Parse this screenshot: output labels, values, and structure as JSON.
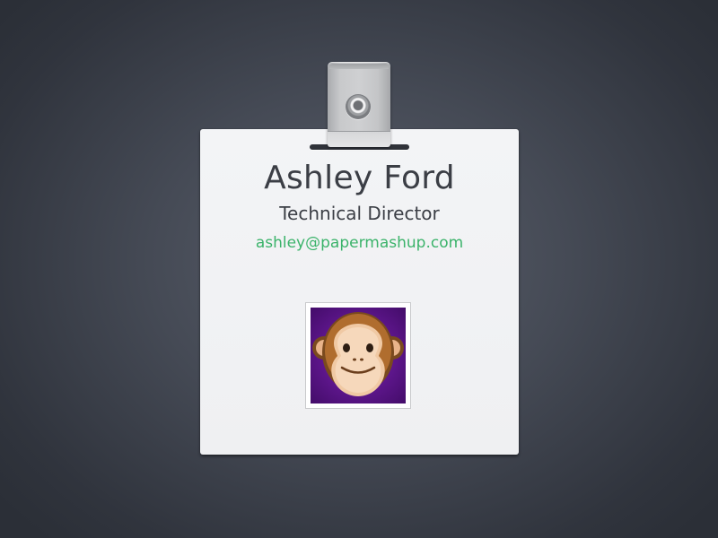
{
  "badge": {
    "name": "Ashley Ford",
    "title": "Technical Director",
    "email": "ashley@papermashup.com",
    "avatar_icon": "monkey-face-icon",
    "clip_icon": "badge-clip-icon"
  },
  "colors": {
    "background": "#3f434d",
    "card": "#f1f2f4",
    "text": "#3b3e45",
    "email": "#3bb36a",
    "avatar_bg": "#5d168b"
  }
}
